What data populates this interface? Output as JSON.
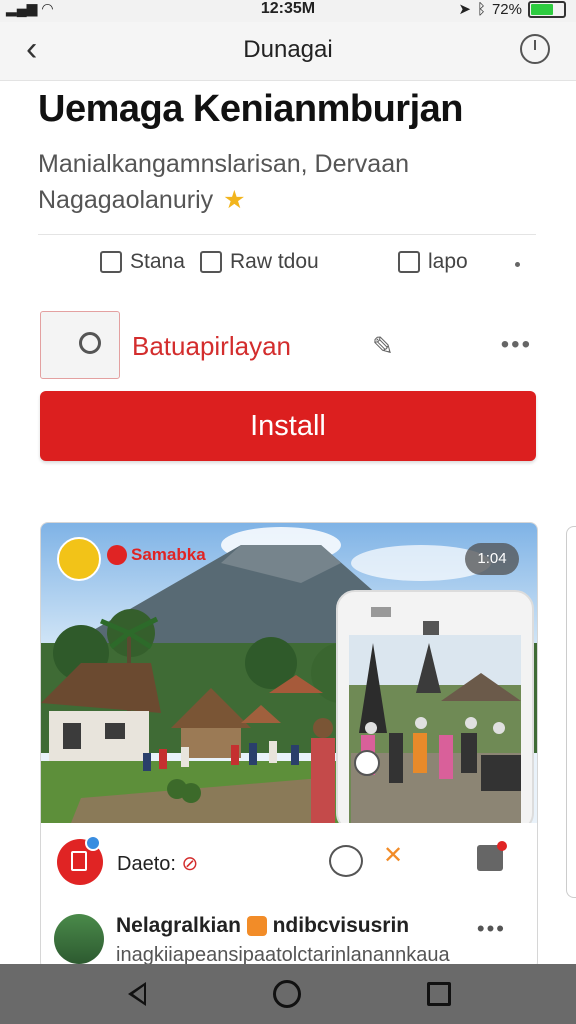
{
  "status_bar": {
    "time": "12:35M",
    "battery_text": "72%",
    "signal_icon": "signal-wifi-icon",
    "battery_level": 0.72
  },
  "app_bar": {
    "title": "Dunagai"
  },
  "app": {
    "name": "Uemaga Kenianmburjan",
    "subtitle_line1": "Manialkangamnslarisan, Dervaan",
    "subtitle_line2": "Nagagaolanuriy"
  },
  "actions": {
    "share_label": "Stana",
    "review_label": "Raw tdou",
    "like_label": "lapo"
  },
  "promo": {
    "label": "Batuapirlayan"
  },
  "install_label": "Install",
  "screenshot": {
    "brand": "Samabka",
    "counter": "1:04"
  },
  "card_footer": {
    "text": "Daeto:"
  },
  "post": {
    "name": "Nelagralkian",
    "name_suffix": "ndibcvisusrin",
    "line2": "inagkiiapeansipaatolctarinlanannkaua"
  },
  "colors": {
    "accent": "#dc1f1f",
    "badge_blue": "#3a8de0"
  }
}
